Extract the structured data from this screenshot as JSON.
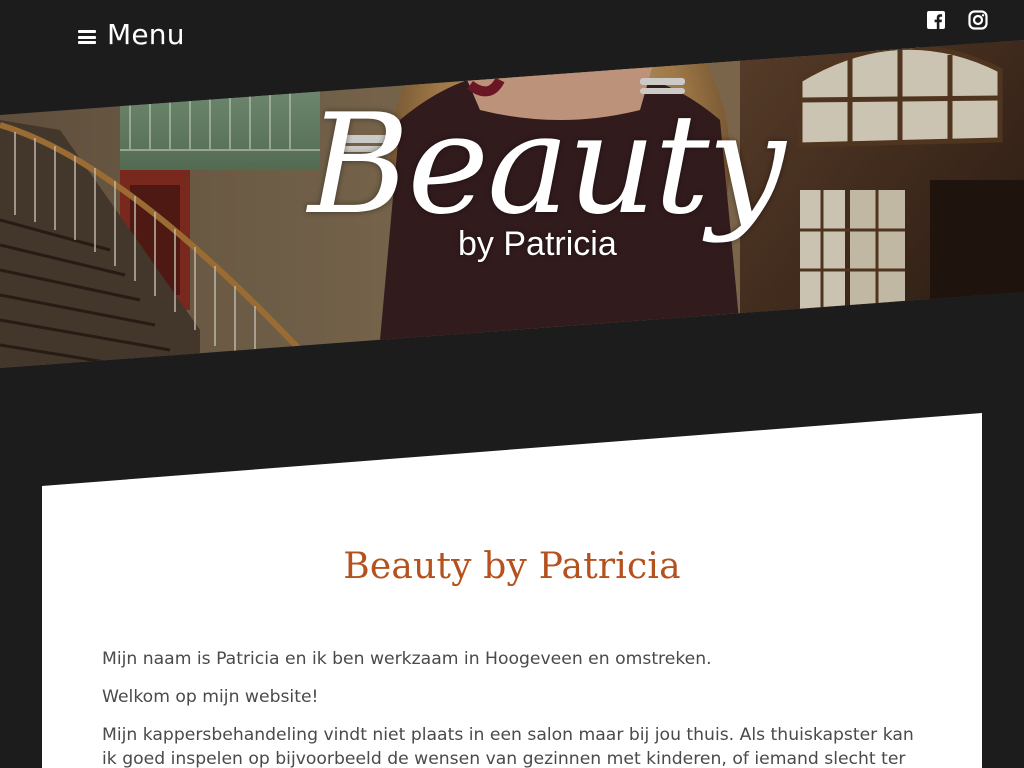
{
  "header": {
    "menu_label": "Menu",
    "social_links": [
      {
        "name": "facebook-icon"
      },
      {
        "name": "instagram-icon"
      }
    ]
  },
  "hero": {
    "logo_script": "Beauty",
    "logo_sub": "by Patricia"
  },
  "main": {
    "title": "Beauty by Patricia",
    "paragraphs": [
      "Mijn naam is Patricia en ik ben werkzaam in Hoogeveen en omstreken.",
      "Welkom op mijn website!",
      "Mijn kappersbehandeling vindt niet plaats in een salon maar bij jou thuis. Als thuiskapster kan ik goed inspelen op bijvoorbeeld de wensen van gezinnen met kinderen, of iemand slecht ter been."
    ]
  },
  "colors": {
    "background": "#1c1c1c",
    "accent": "#b5511d",
    "text": "#4a4a4a",
    "panel": "#ffffff"
  }
}
